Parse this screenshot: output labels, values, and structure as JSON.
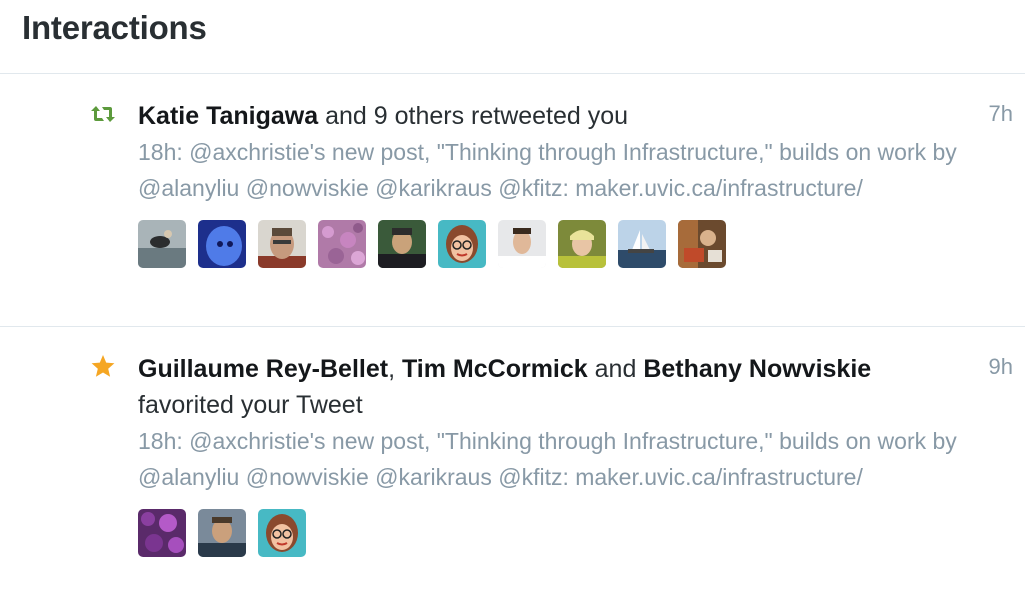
{
  "header": {
    "title": "Interactions"
  },
  "interactions": [
    {
      "icon": "retweet-icon",
      "icon_color": "#5c9a3c",
      "actors": [
        "Katie Tanigawa"
      ],
      "action_text": " and 9 others retweeted you",
      "time": "7h",
      "tweet_text": "18h: @axchristie's new post, \"Thinking through Infrastructure,\" builds on work by @alanyliu @nowviskie @karikraus @kfitz: maker.uvic.ca/infrastructure/",
      "avatar_count": 10
    },
    {
      "icon": "star-icon",
      "icon_color": "#f5a623",
      "actors": [
        "Guillaume Rey-Bellet",
        "Tim McCormick",
        "Bethany Nowviskie"
      ],
      "separator_1": ", ",
      "separator_2": " and ",
      "action_text": " favorited your Tweet",
      "time": "9h",
      "tweet_text": "18h: @axchristie's new post, \"Thinking through Infrastructure,\" builds on work by @alanyliu @nowviskie @karikraus @kfitz: maker.uvic.ca/infrastructure/",
      "avatar_count": 3
    }
  ]
}
